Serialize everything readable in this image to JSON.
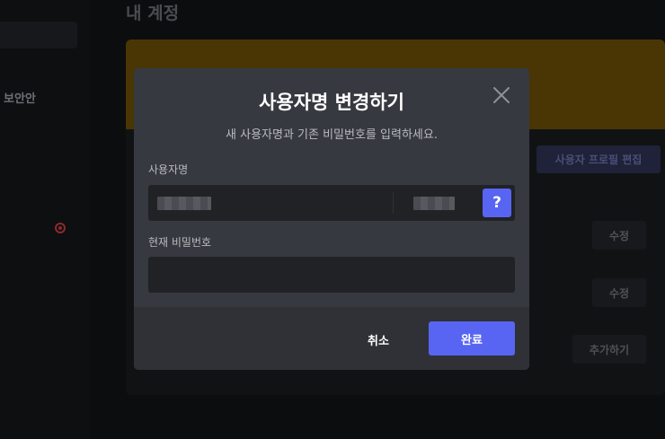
{
  "background": {
    "heading": "내 계정",
    "sidebar_label": "보안안",
    "profile_button": "사용자 프로필 편집",
    "edit_button_1": "수정",
    "edit_button_2": "수정",
    "add_button": "추가하기"
  },
  "modal": {
    "title": "사용자명 변경하기",
    "subtitle": "새 사용자명과 기존 비밀번호를 입력하세요.",
    "username_label": "사용자명",
    "username_value": "",
    "tag_value": "",
    "help_label": "?",
    "password_label": "현재 비밀번호",
    "password_value": "",
    "cancel_label": "취소",
    "submit_label": "완료",
    "close_icon": "close-icon"
  },
  "colors": {
    "accent": "#5865f2",
    "modal_bg": "#36393f",
    "footer_bg": "#2f3136",
    "input_bg": "#202225",
    "banner": "#4a3605"
  }
}
